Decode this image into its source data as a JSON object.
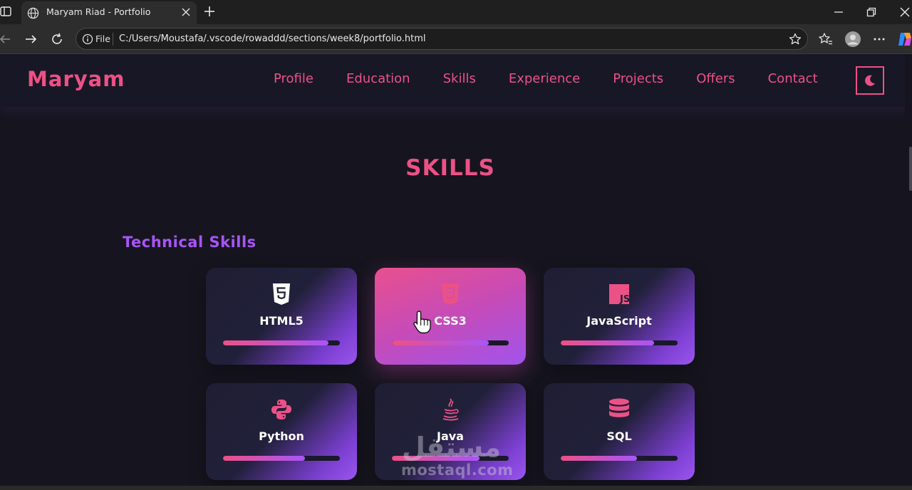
{
  "browser": {
    "tab_title": "Maryam Riad - Portfolio",
    "address_scheme": "File",
    "address_url": "C:/Users/Moustafa/.vscode/rowaddd/sections/week8/portfolio.html"
  },
  "nav": {
    "logo": "Maryam",
    "links": [
      "Profile",
      "Education",
      "Skills",
      "Experience",
      "Projects",
      "Offers",
      "Contact"
    ],
    "theme_icon": "moon-icon"
  },
  "skills": {
    "title": "SKILLS",
    "subtitle": "Technical Skills",
    "cards": [
      {
        "name": "HTML5",
        "icon": "html5-icon",
        "level": 0.9
      },
      {
        "name": "CSS3",
        "icon": "css3-icon",
        "level": 0.83
      },
      {
        "name": "JavaScript",
        "icon": "javascript-icon",
        "level": 0.8
      },
      {
        "name": "Python",
        "icon": "python-icon",
        "level": 0.7
      },
      {
        "name": "Java",
        "icon": "java-icon",
        "level": 0.75
      },
      {
        "name": "SQL",
        "icon": "database-icon",
        "level": 0.65
      }
    ]
  },
  "watermark": {
    "arabic": "مستقل",
    "latin": "mostaql.com"
  },
  "colors": {
    "accent": "#ec5186",
    "purple": "#a855f7",
    "background": "#16151f"
  }
}
